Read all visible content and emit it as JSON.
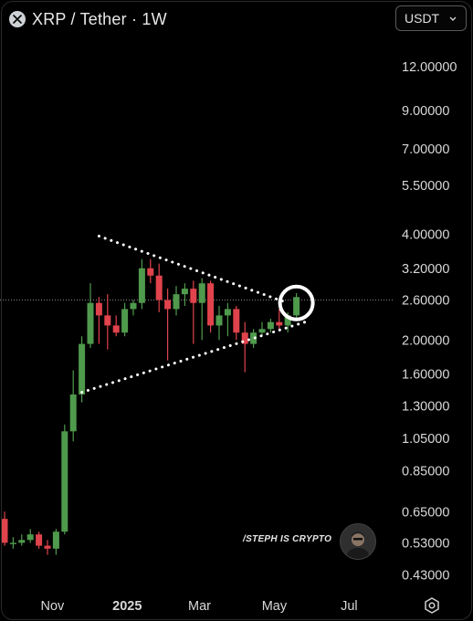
{
  "header": {
    "title": "XRP / Tether · 1W",
    "currency_label": "USDT",
    "logo_icon": "xrp-logo-icon",
    "dropdown_icon": "chevron-down-icon"
  },
  "watermark": {
    "text": "/STEPH IS CRYPTO"
  },
  "footer": {
    "settings_icon": "hexagon-gear-icon"
  },
  "colors": {
    "background": "#000000",
    "up": "#4f9a4c",
    "down": "#e0434c",
    "trendline": "#ffffff",
    "highlight_circle": "#ffffff"
  },
  "chart_data": {
    "type": "candlestick",
    "title": "XRP / Tether · 1W",
    "interval": "1W",
    "y_scale": "log",
    "ylim": [
      0.38,
      15.5
    ],
    "y_ticks": [
      12.0,
      9.0,
      7.0,
      5.5,
      4.0,
      3.2,
      2.6,
      2.0,
      1.6,
      1.3,
      1.05,
      0.85,
      0.65,
      0.53,
      0.43
    ],
    "y_tick_labels": [
      "12.00000",
      "9.00000",
      "7.00000",
      "5.50000",
      "4.00000",
      "3.20000",
      "2.60000",
      "2.00000",
      "1.60000",
      "1.30000",
      "1.05000",
      "0.85000",
      "0.65000",
      "0.53000",
      "0.43000"
    ],
    "x_tick_labels": [
      "Nov",
      "2025",
      "Mar",
      "May",
      "Jul"
    ],
    "x_tick_dates": [
      "2024-11-01",
      "2025-01-01",
      "2025-03-01",
      "2025-05-01",
      "2025-07-01"
    ],
    "xlim": [
      "2024-09-23",
      "2025-08-04"
    ],
    "current_price": 2.6,
    "candles": [
      {
        "date": "2024-09-23",
        "open": 0.62,
        "high": 0.65,
        "low": 0.52,
        "close": 0.53
      },
      {
        "date": "2024-09-30",
        "open": 0.53,
        "high": 0.55,
        "low": 0.51,
        "close": 0.53
      },
      {
        "date": "2024-10-07",
        "open": 0.53,
        "high": 0.56,
        "low": 0.52,
        "close": 0.54
      },
      {
        "date": "2024-10-14",
        "open": 0.54,
        "high": 0.58,
        "low": 0.53,
        "close": 0.56
      },
      {
        "date": "2024-10-21",
        "open": 0.56,
        "high": 0.57,
        "low": 0.51,
        "close": 0.52
      },
      {
        "date": "2024-10-28",
        "open": 0.52,
        "high": 0.54,
        "low": 0.49,
        "close": 0.51
      },
      {
        "date": "2024-11-04",
        "open": 0.51,
        "high": 0.58,
        "low": 0.49,
        "close": 0.57
      },
      {
        "date": "2024-11-11",
        "open": 0.57,
        "high": 1.15,
        "low": 0.56,
        "close": 1.1
      },
      {
        "date": "2024-11-18",
        "open": 1.1,
        "high": 1.64,
        "low": 1.03,
        "close": 1.4
      },
      {
        "date": "2024-11-25",
        "open": 1.4,
        "high": 2.05,
        "low": 1.33,
        "close": 1.95
      },
      {
        "date": "2024-12-02",
        "open": 1.95,
        "high": 2.9,
        "low": 1.9,
        "close": 2.55
      },
      {
        "date": "2024-12-09",
        "open": 2.55,
        "high": 2.65,
        "low": 1.95,
        "close": 2.35
      },
      {
        "date": "2024-12-16",
        "open": 2.35,
        "high": 2.7,
        "low": 1.88,
        "close": 2.2
      },
      {
        "date": "2024-12-23",
        "open": 2.2,
        "high": 2.35,
        "low": 2.05,
        "close": 2.1
      },
      {
        "date": "2024-12-30",
        "open": 2.1,
        "high": 2.55,
        "low": 2.05,
        "close": 2.45
      },
      {
        "date": "2025-01-06",
        "open": 2.45,
        "high": 2.6,
        "low": 2.35,
        "close": 2.55
      },
      {
        "date": "2025-01-13",
        "open": 2.55,
        "high": 3.4,
        "low": 2.45,
        "close": 3.2
      },
      {
        "date": "2025-01-20",
        "open": 3.2,
        "high": 3.4,
        "low": 2.9,
        "close": 3.05
      },
      {
        "date": "2025-01-27",
        "open": 3.05,
        "high": 3.3,
        "low": 2.4,
        "close": 2.6
      },
      {
        "date": "2025-02-03",
        "open": 2.6,
        "high": 2.8,
        "low": 1.75,
        "close": 2.45
      },
      {
        "date": "2025-02-10",
        "open": 2.45,
        "high": 2.85,
        "low": 2.35,
        "close": 2.7
      },
      {
        "date": "2025-02-17",
        "open": 2.7,
        "high": 2.9,
        "low": 2.5,
        "close": 2.8
      },
      {
        "date": "2025-02-24",
        "open": 2.8,
        "high": 2.95,
        "low": 1.95,
        "close": 2.55
      },
      {
        "date": "2025-03-03",
        "open": 2.55,
        "high": 3.0,
        "low": 2.0,
        "close": 2.9
      },
      {
        "date": "2025-03-10",
        "open": 2.9,
        "high": 2.95,
        "low": 2.1,
        "close": 2.2
      },
      {
        "date": "2025-03-17",
        "open": 2.2,
        "high": 2.5,
        "low": 2.0,
        "close": 2.35
      },
      {
        "date": "2025-03-24",
        "open": 2.35,
        "high": 2.55,
        "low": 2.05,
        "close": 2.45
      },
      {
        "date": "2025-03-31",
        "open": 2.45,
        "high": 2.5,
        "low": 2.0,
        "close": 2.1
      },
      {
        "date": "2025-04-07",
        "open": 2.1,
        "high": 2.25,
        "low": 1.62,
        "close": 1.95
      },
      {
        "date": "2025-04-14",
        "open": 1.95,
        "high": 2.15,
        "low": 1.9,
        "close": 2.1
      },
      {
        "date": "2025-04-21",
        "open": 2.1,
        "high": 2.25,
        "low": 2.05,
        "close": 2.15
      },
      {
        "date": "2025-04-28",
        "open": 2.15,
        "high": 2.3,
        "low": 2.1,
        "close": 2.25
      },
      {
        "date": "2025-05-05",
        "open": 2.25,
        "high": 2.45,
        "low": 2.12,
        "close": 2.2
      },
      {
        "date": "2025-05-12",
        "open": 2.2,
        "high": 2.4,
        "low": 2.1,
        "close": 2.35
      },
      {
        "date": "2025-05-19",
        "open": 2.35,
        "high": 2.72,
        "low": 2.3,
        "close": 2.65
      }
    ],
    "annotations": {
      "upper_trendline": {
        "from": {
          "date": "2024-12-09",
          "price": 3.95
        },
        "to": {
          "date": "2025-05-12",
          "price": 2.55
        }
      },
      "lower_trendline": {
        "from": {
          "date": "2024-11-25",
          "price": 1.42
        },
        "to": {
          "date": "2025-05-26",
          "price": 2.25
        }
      },
      "highlight_circle": {
        "date": "2025-05-19",
        "price": 2.55
      }
    }
  }
}
